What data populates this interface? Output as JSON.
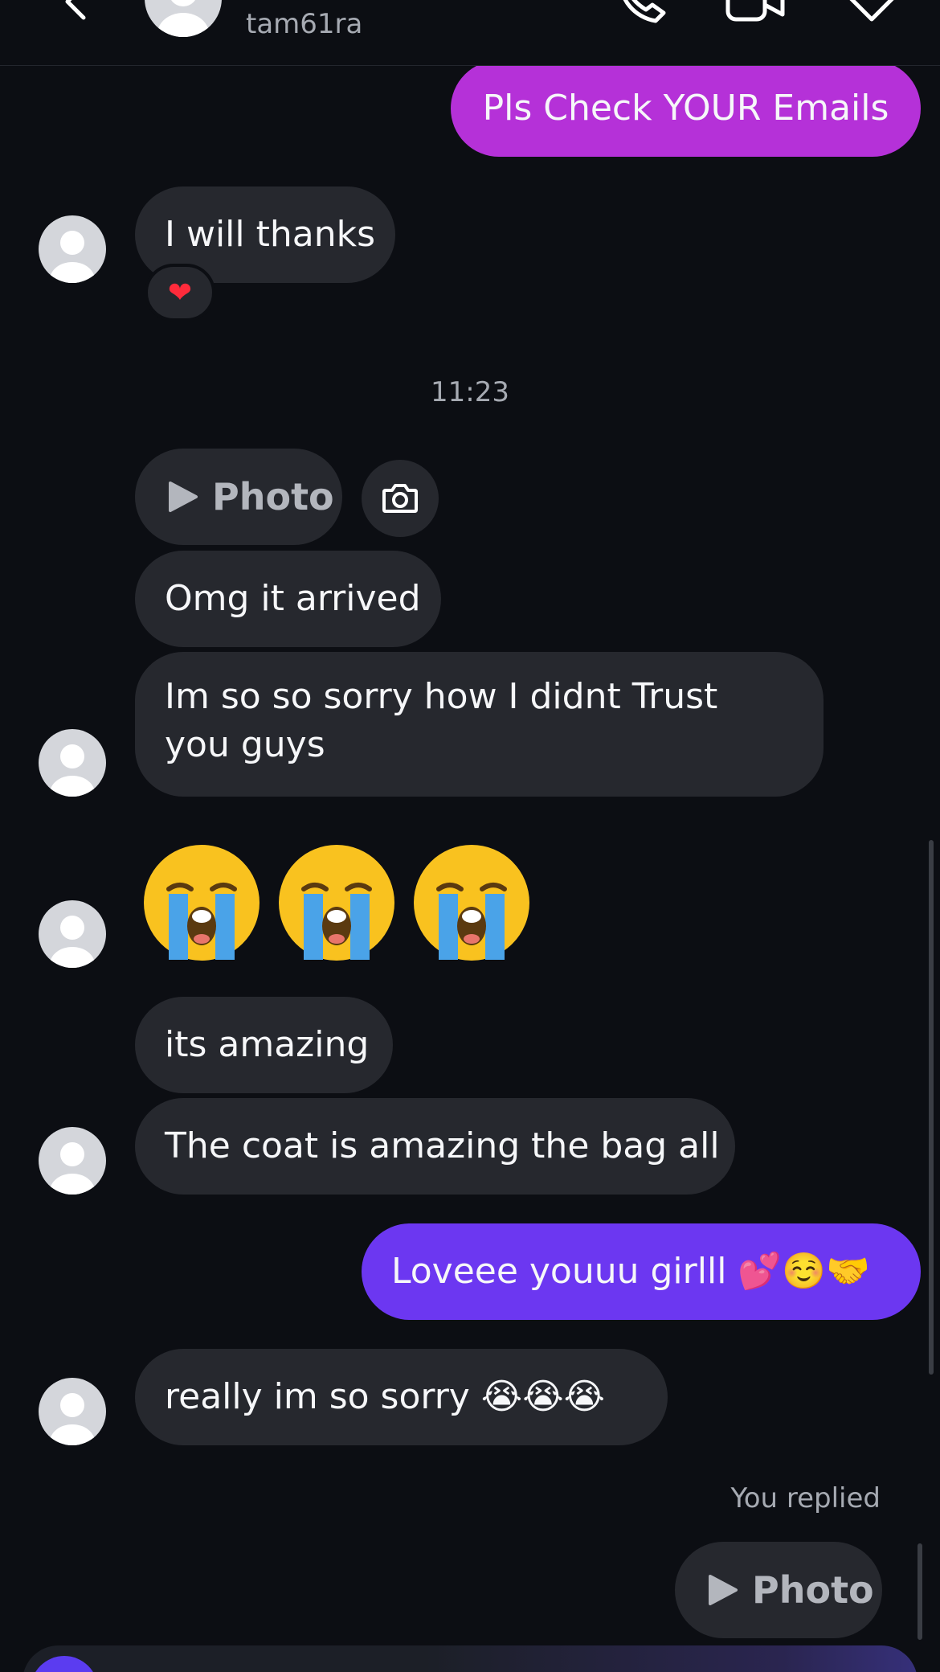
{
  "header": {
    "username": "tam61ra",
    "icons": [
      "back-chevron-icon",
      "phone-icon",
      "video-camera-icon",
      "tag-icon"
    ]
  },
  "messages": {
    "m1": "Pls Check YOUR Emails",
    "m2": "I will thanks",
    "m2_reaction": "❤",
    "timestamp": "11:23",
    "photo_label": "Photo",
    "m3": "Omg it arrived",
    "m4": "Im so so sorry how I didnt Trust you guys",
    "m5": "its amazing",
    "m6": "The coat is amazing the bag all",
    "m7": "Loveee youuu girlll 💕☺️🤝",
    "m8": "really im so sorry 😭😭😭",
    "replied_label": "You replied",
    "reply_photo_label": "Photo"
  },
  "colors": {
    "background": "#0c0e13",
    "incoming_bubble": "#26282e",
    "outgoing_magenta": "#b531d8",
    "outgoing_purple": "#6c37f1",
    "secondary_text": "#a6aab2"
  }
}
